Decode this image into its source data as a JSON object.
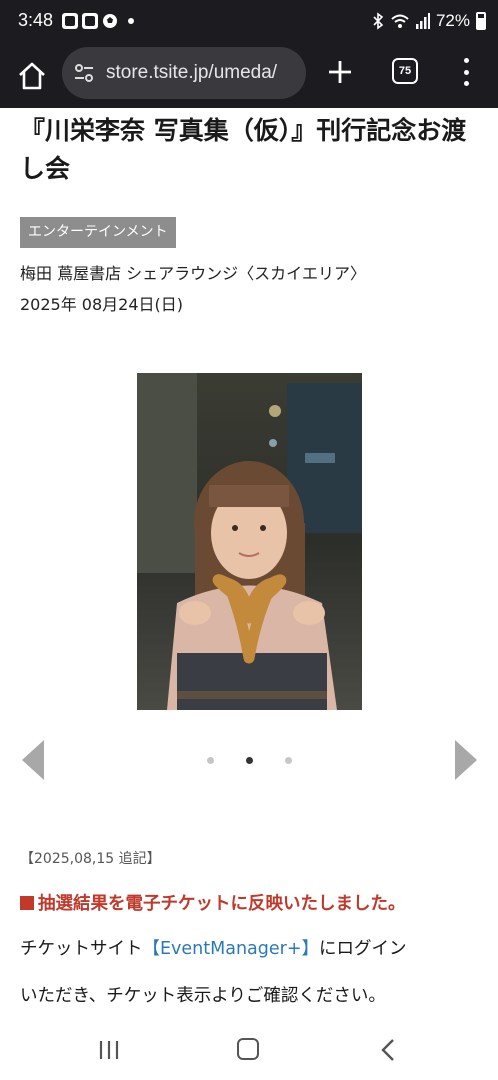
{
  "status_bar": {
    "time": "3:48",
    "battery": "72%",
    "icons": [
      "gallery-icon",
      "pay-icon",
      "soccer-icon",
      "notification-dot",
      "bluetooth-icon",
      "wifi-icon",
      "signal-icon",
      "battery-icon"
    ]
  },
  "browser": {
    "url": "store.tsite.jp/umeda/",
    "tab_count": "75",
    "icons": [
      "home-icon",
      "site-settings-icon",
      "new-tab-icon",
      "tab-switcher-icon",
      "menu-icon"
    ]
  },
  "event": {
    "title": "『川栄李奈 写真集（仮）』刊行記念お渡し会",
    "category": "エンターテインメント",
    "venue": "梅田 蔦屋書店 シェアラウンジ〈スカイエリア〉",
    "date": "2025年 08月24日(日)"
  },
  "carousel": {
    "slide_count": 3,
    "active_index": 1
  },
  "update": {
    "note": "【2025,08,15 追記】",
    "notice": "抽選結果を電子チケットに反映いたしました。",
    "line1_before": "チケットサイト",
    "link": "【EventManager+】",
    "line1_after": "にログイン",
    "line2": "いただき、チケット表示よりご確認ください。"
  },
  "colors": {
    "accent_red": "#c0392b",
    "link_blue": "#2a7ab8",
    "badge_gray": "#8d8d8d",
    "chrome_dark": "#1c1b1f"
  }
}
